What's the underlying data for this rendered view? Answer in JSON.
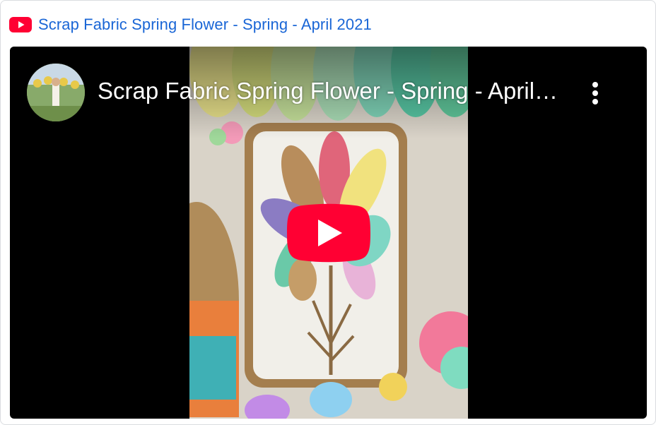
{
  "header": {
    "logo_icon": "youtube-logo-icon",
    "link_text": "Scrap Fabric Spring Flower - Spring - April 2021",
    "link_color": "#1a66d6"
  },
  "player": {
    "video_title": "Scrap Fabric Spring Flower - Spring - April 2021",
    "avatar_icon": "channel-avatar",
    "menu_icon": "more-vert-icon",
    "play_icon": "play-button-icon",
    "play_color": "#ff0033"
  }
}
